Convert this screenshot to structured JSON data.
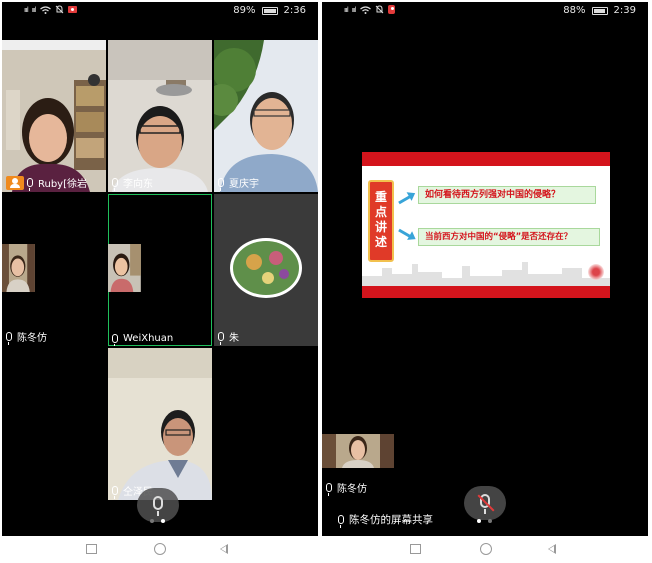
{
  "left_phone": {
    "status": {
      "battery": "89%",
      "time": "2:36"
    },
    "participants": [
      {
        "name": "Ruby[徐岩",
        "host": true
      },
      {
        "name": "李向东"
      },
      {
        "name": "夏庆宇"
      },
      {
        "name": "陈冬仿"
      },
      {
        "name": "WeiXhuan",
        "active": true
      },
      {
        "name": "朱"
      },
      {
        "name": "仝泽民"
      }
    ],
    "page_indicator": {
      "count": 2,
      "current": 2
    }
  },
  "right_phone": {
    "status": {
      "battery": "88%",
      "time": "2:39"
    },
    "slide": {
      "key_label": "重点讲述",
      "question_1": "如何看待西方列强对中国的侵略？",
      "question_2": "当前西方对中国的“侵略”是否还存在？"
    },
    "thumbnail": {
      "name": "陈冬仿"
    },
    "share_label": "陈冬仿的屏幕共享",
    "page_indicator": {
      "count": 2,
      "current": 1
    }
  },
  "colors": {
    "accent_green": "#1fbf5b",
    "host_orange": "#f08a1d",
    "slide_red": "#d4141c",
    "mute_red": "#e23b3b"
  },
  "icons": [
    "wifi-icon",
    "signal-icon",
    "recording-icon",
    "battery-icon",
    "mic-icon",
    "host-icon",
    "mute-mic-icon",
    "nav-recent-icon",
    "nav-home-icon",
    "nav-back-icon"
  ]
}
